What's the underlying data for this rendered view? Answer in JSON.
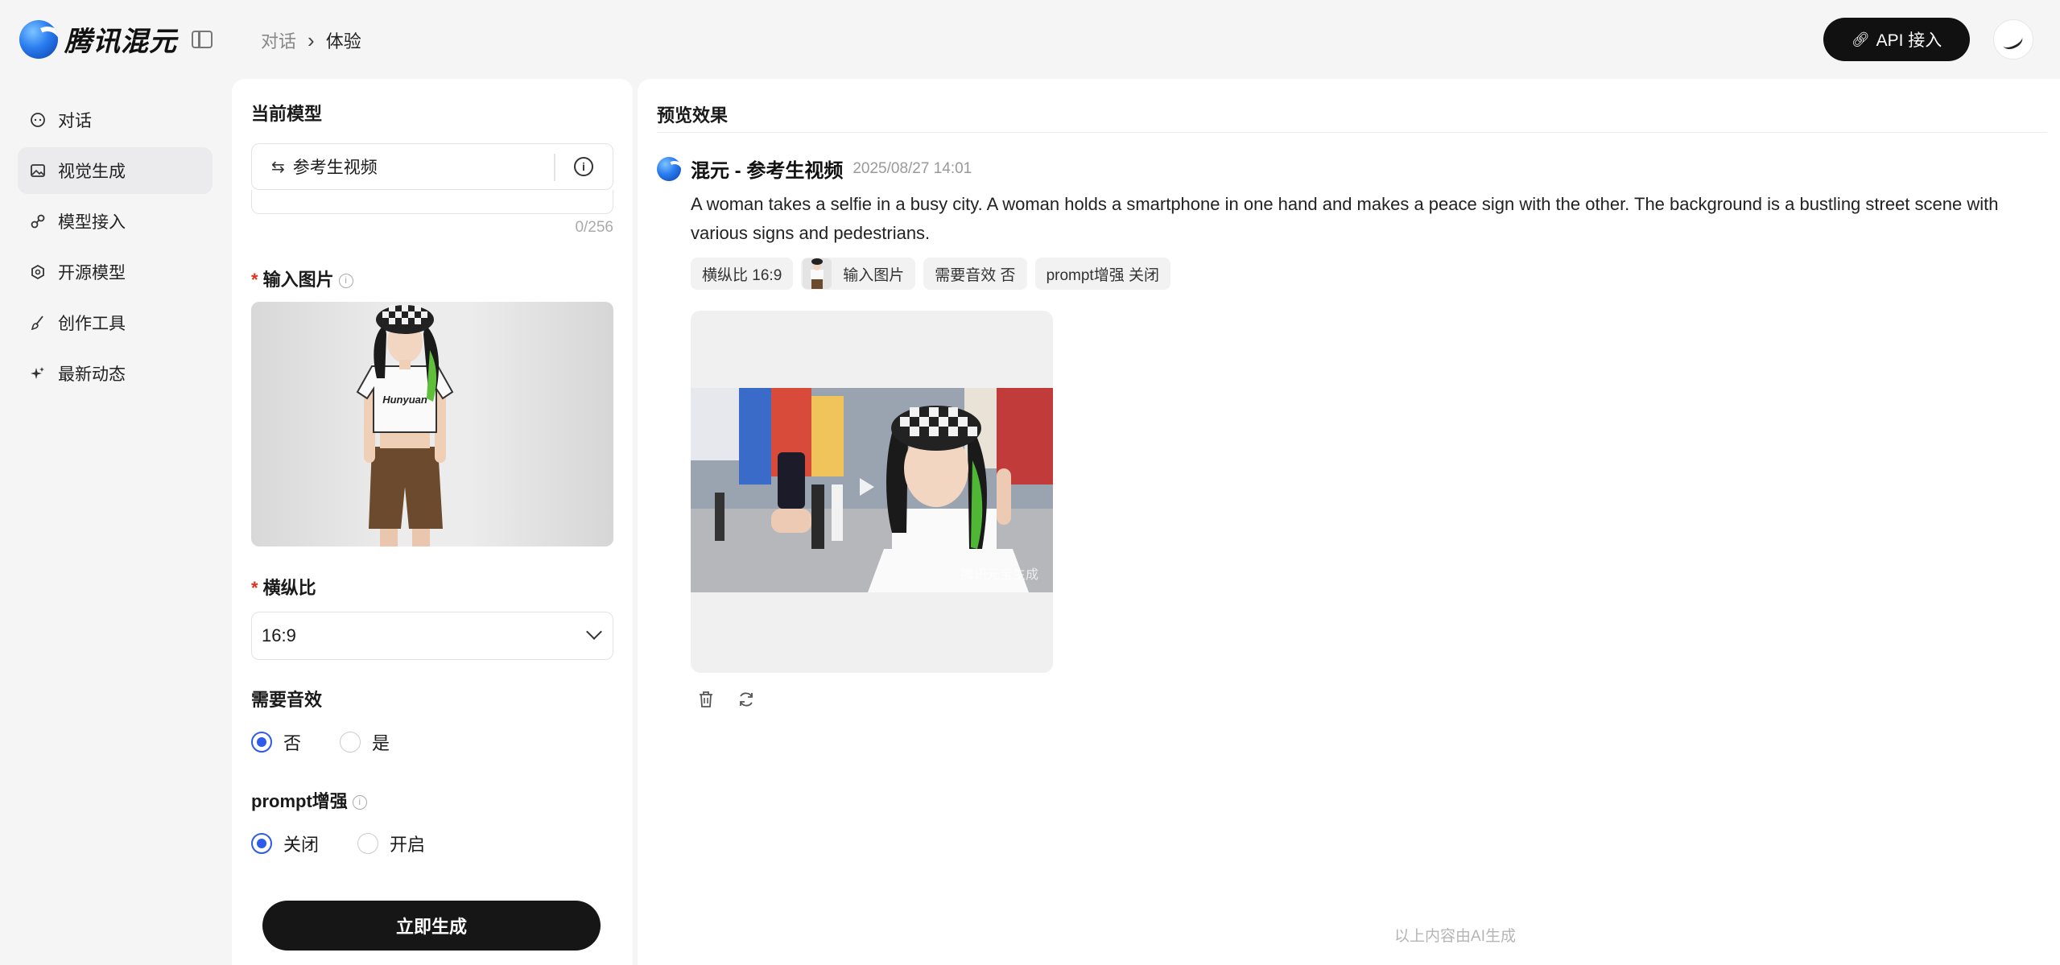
{
  "header": {
    "logo_text": "腾讯混元",
    "breadcrumb": [
      "对话",
      "体验"
    ],
    "api_button": "API 接入"
  },
  "sidebar": {
    "items": [
      {
        "label": "对话",
        "icon": "chat-icon"
      },
      {
        "label": "视觉生成",
        "icon": "image-icon",
        "active": true
      },
      {
        "label": "模型接入",
        "icon": "link-icon"
      },
      {
        "label": "开源模型",
        "icon": "open-source-icon"
      },
      {
        "label": "创作工具",
        "icon": "brush-icon"
      },
      {
        "label": "最新动态",
        "icon": "sparkle-icon"
      }
    ]
  },
  "settings": {
    "current_model_title": "当前模型",
    "model_name": "参考生视频",
    "prompt_counter": "0/256",
    "input_image_title": "输入图片",
    "aspect_ratio_title": "横纵比",
    "aspect_ratio_value": "16:9",
    "audio_title": "需要音效",
    "audio_options": [
      "否",
      "是"
    ],
    "audio_selected": "否",
    "prompt_enhance_title": "prompt增强",
    "prompt_enhance_options": [
      "关闭",
      "开启"
    ],
    "prompt_enhance_selected": "关闭",
    "generate_button": "立即生成",
    "required_mark": "*"
  },
  "preview": {
    "title": "预览效果",
    "message": {
      "name": "混元 - 参考生视频",
      "time": "2025/08/27 14:01",
      "prompt": "A woman takes a selfie in a busy city. A woman holds a smartphone in one hand and makes a peace sign with the other. The background is a bustling street scene with various signs and pedestrians.",
      "tags": [
        "横纵比 16:9",
        "输入图片",
        "需要音效 否",
        "prompt增强 关闭"
      ],
      "video_watermark": "腾讯元宝生成"
    },
    "footer_note": "以上内容由AI生成"
  },
  "colors": {
    "accent": "#2f5bea",
    "required": "#e0301e",
    "button_dark": "#161616"
  }
}
